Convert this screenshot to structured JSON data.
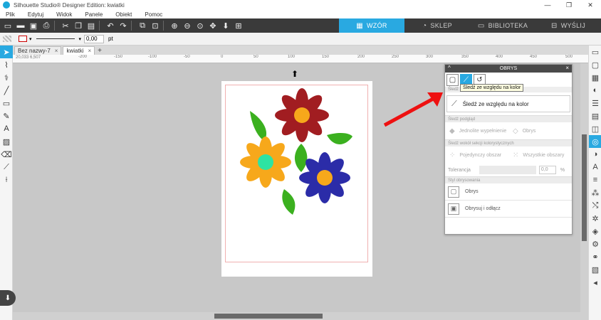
{
  "window": {
    "title": "Silhouette Studio® Designer Edition: kwiatki",
    "controls": [
      "—",
      "❐",
      "✕"
    ]
  },
  "menu": [
    "Plik",
    "Edytuj",
    "Widok",
    "Panele",
    "Obiekt",
    "Pomoc"
  ],
  "toolbar": {
    "icons": [
      "new-file-icon",
      "open-icon",
      "save-icon",
      "print-icon",
      "cut-icon",
      "copy-icon",
      "paste-icon",
      "undo-icon",
      "redo-icon",
      "group-icon",
      "ungroup-icon",
      "zoom-in-icon",
      "zoom-out-icon",
      "zoom-fit-icon",
      "pan-icon",
      "fit-page-icon",
      "add-page-icon"
    ],
    "tabs": [
      {
        "label": "WZÓR",
        "icon": "design-icon",
        "active": true
      },
      {
        "label": "SKLEP",
        "icon": "store-icon",
        "active": false
      },
      {
        "label": "BIBLIOTEKA",
        "icon": "library-icon",
        "active": false
      },
      {
        "label": "WYŚLIJ",
        "icon": "send-icon",
        "active": false
      }
    ]
  },
  "propbar": {
    "line_width_value": "0,00",
    "unit": "pt"
  },
  "doc_tabs": [
    {
      "label": "Bez nazwy-7",
      "active": false
    },
    {
      "label": "kwiatki",
      "active": true
    }
  ],
  "ruler": {
    "coordinates": "20,033  6,507",
    "ticks": [
      "-250",
      "-200",
      "-150",
      "-100",
      "-50",
      "0",
      "50",
      "100",
      "150",
      "200",
      "250",
      "300",
      "350",
      "400",
      "450",
      "500",
      "550",
      "600",
      "650",
      "700"
    ]
  },
  "panel": {
    "title": "OBRYS",
    "tooltip": "Śledź ze względu na kolor",
    "sublabel": "Śledź ze w…",
    "trace_color_label": "Śledź ze względu na kolor",
    "section_view": "Śledź podgląd",
    "opt_fill": "Jednolite wypełnienie",
    "opt_outline": "Obrys",
    "section_trace": "Śledź wokół sekcji kolorystycznych",
    "opt_single": "Pojedynczy obszar",
    "opt_all": "Wszystkie obszary",
    "tolerance_label": "Tolerancja",
    "tolerance_value": "0,0",
    "tolerance_unit": "%",
    "section_style": "Styl obrysowania",
    "style_trace": "Obrys",
    "style_trace_release": "Obrysuj i odłącz"
  },
  "colors": {
    "accent": "#29a9e1",
    "flower_red": "#a11d21",
    "flower_orange": "#f7a81b",
    "flower_blue": "#2b2ca8",
    "center_gold": "#f7a81b",
    "center_mint": "#2ee3a2",
    "leaf_green": "#3bb01f",
    "arrow_red": "#ee1111"
  }
}
